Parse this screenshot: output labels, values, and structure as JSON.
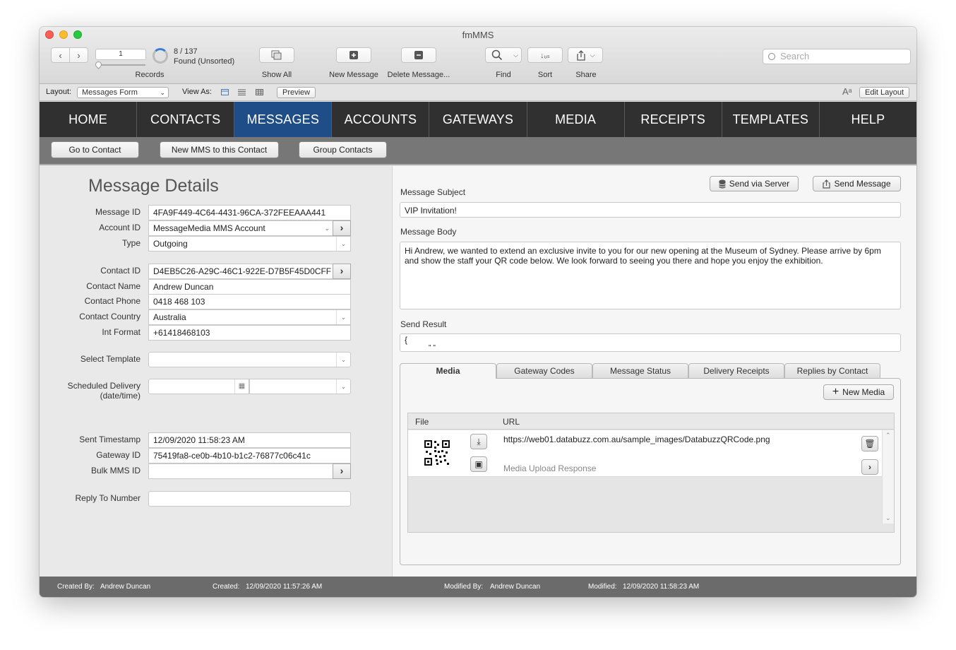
{
  "window": {
    "title": "fmMMS"
  },
  "toolbar": {
    "record_number": "1",
    "record_count": "8 / 137",
    "found_status": "Found (Unsorted)",
    "records_label": "Records",
    "show_all_label": "Show All",
    "new_message_label": "New Message",
    "delete_message_label": "Delete Message...",
    "find_label": "Find",
    "sort_label": "Sort",
    "share_label": "Share",
    "search_placeholder": "Search"
  },
  "layout_bar": {
    "layout_label": "Layout:",
    "layout_value": "Messages Form",
    "view_as_label": "View As:",
    "preview_label": "Preview",
    "text_size_label": "Aᵃ",
    "edit_layout_label": "Edit Layout"
  },
  "nav": {
    "items": [
      "HOME",
      "CONTACTS",
      "MESSAGES",
      "ACCOUNTS",
      "GATEWAYS",
      "MEDIA",
      "RECEIPTS",
      "TEMPLATES",
      "HELP"
    ],
    "active": "MESSAGES"
  },
  "subbar": {
    "go_to_contact": "Go to Contact",
    "new_mms": "New MMS to this Contact",
    "group_contacts": "Group Contacts"
  },
  "details": {
    "heading": "Message Details",
    "message_id_label": "Message ID",
    "message_id": "4FA9F449-4C64-4431-96CA-372FEEAAA441",
    "account_id_label": "Account ID",
    "account_id": "MessageMedia MMS Account",
    "type_label": "Type",
    "type": "Outgoing",
    "contact_id_label": "Contact ID",
    "contact_id": "D4EB5C26-A29C-46C1-922E-D7B5F45D0CFF",
    "contact_name_label": "Contact Name",
    "contact_name": "Andrew Duncan",
    "contact_phone_label": "Contact Phone",
    "contact_phone": "0418 468 103",
    "contact_country_label": "Contact Country",
    "contact_country": "Australia",
    "int_format_label": "Int Format",
    "int_format": "+61418468103",
    "select_template_label": "Select Template",
    "select_template": "",
    "scheduled_label_1": "Scheduled Delivery",
    "scheduled_label_2": "(date/time)",
    "sent_timestamp_label": "Sent Timestamp",
    "sent_timestamp": "12/09/2020 11:58:23 AM",
    "gateway_id_label": "Gateway ID",
    "gateway_id": "75419fa8-ce0b-4b10-b1c2-76877c06c41c",
    "bulk_mms_id_label": "Bulk MMS ID",
    "bulk_mms_id": "",
    "reply_to_label": "Reply To Number",
    "reply_to": ""
  },
  "message": {
    "send_via_server": "Send via Server",
    "send_message": "Send Message",
    "subject_label": "Message Subject",
    "subject": "VIP Invitation!",
    "body_label": "Message Body",
    "body": "Hi Andrew, we wanted to extend an exclusive invite to you for our new opening at the Museum of Sydney. Please arrive by 6pm and show the staff your QR code below. We look forward to seeing you there and hope you enjoy the exhibition.",
    "send_result_label": "Send Result",
    "send_result_line1": "{",
    "send_result_line2": "\"      \""
  },
  "tabs": {
    "items": [
      "Media",
      "Gateway Codes",
      "Message Status",
      "Delivery Receipts",
      "Replies by Contact"
    ],
    "active": "Media"
  },
  "media": {
    "new_media": "New Media",
    "col_file": "File",
    "col_url": "URL",
    "rows": [
      {
        "url": "https://web01.databuzz.com.au/sample_images/DatabuzzQRCode.png",
        "upload_response": "Media Upload Response"
      }
    ]
  },
  "footer": {
    "created_by_label": "Created By:",
    "created_by": "Andrew Duncan",
    "created_label": "Created:",
    "created": "12/09/2020 11:57:26 AM",
    "modified_by_label": "Modified By:",
    "modified_by": "Andrew Duncan",
    "modified_label": "Modified:",
    "modified": "12/09/2020 11:58:23 AM"
  },
  "colors": {
    "nav_bg": "#303030",
    "nav_active": "#1f4d87",
    "subbar_bg": "#777777",
    "footer_bg": "#6b6b6b"
  }
}
